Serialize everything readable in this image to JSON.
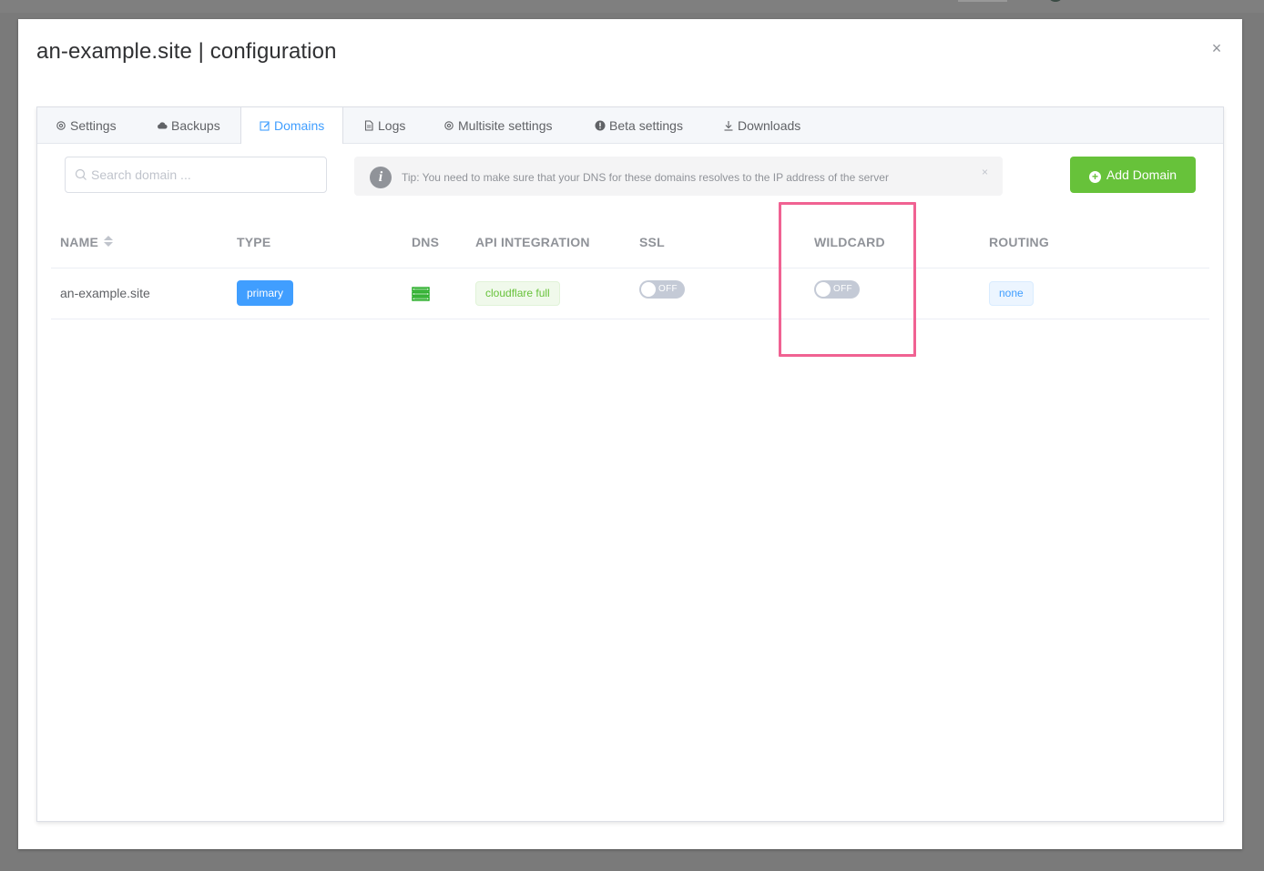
{
  "modal": {
    "title": "an-example.site | configuration",
    "close_glyph": "×"
  },
  "tabs": [
    {
      "label": "Settings",
      "icon": "gear-icon"
    },
    {
      "label": "Backups",
      "icon": "cloud-icon"
    },
    {
      "label": "Domains",
      "icon": "edit-icon",
      "active": true
    },
    {
      "label": "Logs",
      "icon": "document-icon"
    },
    {
      "label": "Multisite settings",
      "icon": "gear-icon"
    },
    {
      "label": "Beta settings",
      "icon": "warning-icon"
    },
    {
      "label": "Downloads",
      "icon": "download-icon"
    }
  ],
  "search": {
    "placeholder": "Search domain ..."
  },
  "tip": {
    "icon_glyph": "i",
    "text": "Tip: You need to make sure that your DNS for these domains resolves to the IP address of the server",
    "close_glyph": "×"
  },
  "add_button": {
    "icon_glyph": "+",
    "label": "Add Domain"
  },
  "table": {
    "headers": {
      "name": "NAME",
      "type": "TYPE",
      "dns": "DNS",
      "api": "API INTEGRATION",
      "ssl": "SSL",
      "wildcard": "WILDCARD",
      "routing": "ROUTING"
    },
    "rows": [
      {
        "name": "an-example.site",
        "type": "primary",
        "dns_icon": "server-icon",
        "api": "cloudflare full",
        "ssl": "OFF",
        "wildcard": "OFF",
        "routing": "none"
      }
    ]
  },
  "colors": {
    "primary": "#409eff",
    "success": "#67c23a",
    "highlight": "#f06292",
    "dns_icon": "#1aa81a"
  }
}
